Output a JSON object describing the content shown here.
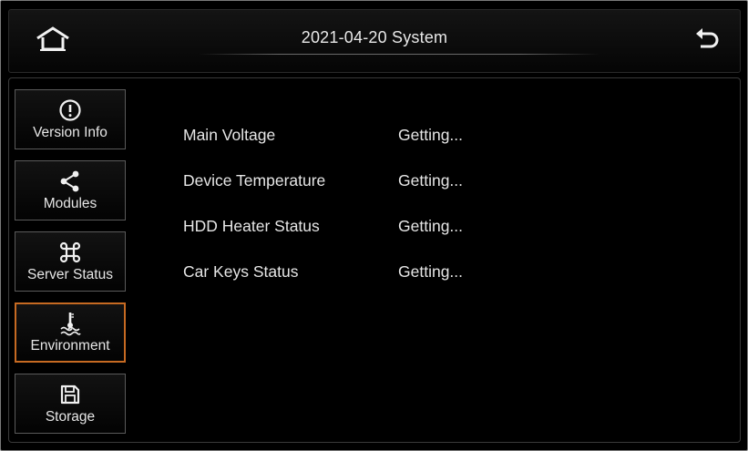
{
  "header": {
    "title": "2021-04-20  System",
    "home_icon": "home-icon",
    "back_icon": "back-arrow-icon"
  },
  "sidebar": {
    "items": [
      {
        "label": "Version Info",
        "icon": "info-circle-icon",
        "active": false
      },
      {
        "label": "Modules",
        "icon": "share-nodes-icon",
        "active": false
      },
      {
        "label": "Server Status",
        "icon": "command-icon",
        "active": false
      },
      {
        "label": "Environment",
        "icon": "thermometer-waves-icon",
        "active": true
      },
      {
        "label": "Storage",
        "icon": "floppy-disk-icon",
        "active": false
      }
    ]
  },
  "main": {
    "rows": [
      {
        "label": "Main Voltage",
        "value": "Getting..."
      },
      {
        "label": "Device Temperature",
        "value": "Getting..."
      },
      {
        "label": "HDD Heater Status",
        "value": "Getting..."
      },
      {
        "label": "Car Keys Status",
        "value": "Getting..."
      }
    ]
  },
  "colors": {
    "background": "#000000",
    "text": "#e6e6e6",
    "active_border": "#c66a22",
    "item_border": "#5a5a5a"
  }
}
